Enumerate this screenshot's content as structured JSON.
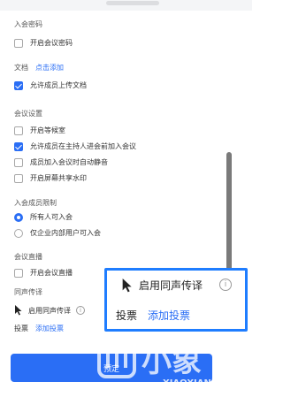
{
  "sections": {
    "entry_password": {
      "title": "入会密码",
      "option": "开启会议密码"
    },
    "documents": {
      "title": "文档",
      "link": "点击添加",
      "option": "允许成员上传文档"
    },
    "meeting_settings": {
      "title": "会议设置",
      "options": [
        {
          "label": "开启等候室",
          "checked": false
        },
        {
          "label": "允许成员在主持人进会前加入会议",
          "checked": true
        },
        {
          "label": "成员加入会议时自动静音",
          "checked": false
        },
        {
          "label": "开启屏幕共享水印",
          "checked": false
        }
      ]
    },
    "member_limit": {
      "title": "入会成员限制",
      "options": [
        {
          "label": "所有人可入会",
          "checked": true
        },
        {
          "label": "仅企业内部用户可入会",
          "checked": false
        }
      ]
    },
    "live": {
      "title": "会议直播",
      "option": "开启会议直播"
    },
    "interpretation": {
      "title": "同声传译",
      "option": "启用同声传译"
    },
    "vote": {
      "label": "投票",
      "link": "添加投票"
    }
  },
  "bottom_button": {
    "label": "预定"
  },
  "callout": {
    "interpretation_label": "启用同声传译",
    "vote_label": "投票",
    "add_vote_link": "添加投票"
  },
  "watermark": {
    "text": "XIAOXIANG",
    "brand_chars": "小象"
  },
  "colors": {
    "accent": "#2a6ef5",
    "callout_border": "#1f7dff"
  }
}
